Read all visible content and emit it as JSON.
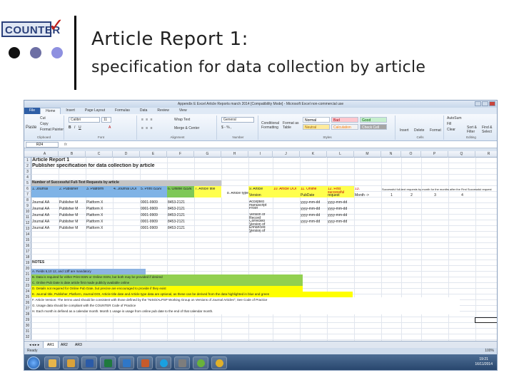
{
  "slide": {
    "logo_text": "COUNTER",
    "title_line1": "Article Report 1:",
    "title_line2": "specification for data collection by article",
    "dot_colors": [
      "#111111",
      "#6d6fa4",
      "#8e90e0"
    ]
  },
  "excel": {
    "window_title": "Appendix E Excel Article Reports march 2014 [Compatibility Mode] - Microsoft Excel non-commercial use",
    "tabs": [
      "File",
      "Home",
      "Insert",
      "Page Layout",
      "Formulas",
      "Data",
      "Review",
      "View"
    ],
    "active_tab": "Home",
    "ribbon": {
      "cut": "Cut",
      "copy": "Copy",
      "format_painter": "Format Painter",
      "paste": "Paste",
      "font_name": "Calibri",
      "font_size": "11",
      "wrap_text": "Wrap Text",
      "merge_center": "Merge & Center",
      "number_format": "General",
      "conditional_formatting": "Conditional Formatting",
      "format_as_table": "Format as Table",
      "style_normal": "Normal",
      "style_bad": "Bad",
      "style_good": "Good",
      "style_neutral": "Neutral",
      "style_calculation": "Calculation",
      "style_check_cell": "Check Cell",
      "insert": "Insert",
      "delete": "Delete",
      "format": "Format",
      "autosum": "AutoSum",
      "fill": "Fill",
      "clear": "Clear",
      "sort_filter": "Sort & Filter",
      "find_select": "Find & Select",
      "group_labels": [
        "Clipboard",
        "Font",
        "Alignment",
        "Number",
        "Styles",
        "Cells",
        "Editing"
      ]
    },
    "name_box": "R24",
    "columns": [
      "A",
      "B",
      "C",
      "D",
      "E",
      "F",
      "G",
      "H",
      "I",
      "J",
      "K",
      "L",
      "M",
      "N",
      "O",
      "P",
      "Q",
      "R"
    ],
    "rows": {
      "r1_title": "Article Report 1",
      "r2_subtitle": "Publisher specification for data collection by article",
      "r5_header": "Number of Successful Full-Text Requests by article",
      "r6": [
        "1. Journal",
        "2. Publisher",
        "3. Platform",
        "4. Journal DOI",
        "5. Print ISSN",
        "6. Online ISSN",
        "7. Article title",
        "9. Article",
        "10. Article DOI",
        "11. Online",
        "12. First successful",
        "13.",
        "Successful full-text requests by month for the months after the First Successful request"
      ],
      "r6_months": [
        "1",
        "2",
        "3",
        "4"
      ],
      "r6_8": "8. Article type",
      "r6_version": "Version",
      "r6_pubdate": "PubDate",
      "r6_request": "request",
      "r6_month": "Month ->",
      "data_rows": [
        [
          "7",
          "Journal AA",
          "Publisher M",
          "Platform X",
          "0001-9909",
          "8453-2121",
          "Accepted manuscript",
          "yyyy-mm-dd",
          "yyyy-mm-dd"
        ],
        [
          "8",
          "Journal AA",
          "Publisher M",
          "Platform X",
          "0001-9909",
          "8453-2121",
          "Proof",
          "yyyy-mm-dd",
          "yyyy-mm-dd"
        ],
        [
          "9",
          "Journal AA",
          "Publisher M",
          "Platform X",
          "0001-9909",
          "8453-2121",
          "Version of Record",
          "yyyy-mm-dd",
          "yyyy-mm-dd"
        ],
        [
          "10",
          "Journal AA",
          "Publisher M",
          "Platform X",
          "0001-9909",
          "8453-2121",
          "Corrected Version of Record",
          "yyyy-mm-dd",
          "yyyy-mm-dd"
        ],
        [
          "11",
          "Journal AA",
          "Publisher M",
          "Platform X",
          "0001-9909",
          "8453-2121",
          "Enhanced Version of Record",
          "",
          ""
        ]
      ],
      "notes_label": "NOTES",
      "notes": [
        "A. Fields 6,10 12, and 13ff are mandatory",
        "B. Data is required for either Print ISSN or Online ISSN, but both may be provided if desired",
        "C. Online Pub Date is date article first made publicly available online",
        "D. Details not required for Online Pub Date, but precise are encouraged to provide if they exist",
        "E. Journal title, Publisher, Platform, Journal DOI, Article title date and Article type data are optional, as these can be derived from the data highlighted in blue and green",
        "F. Article Version: The terms used should be consistent with those defined by the \"NISO/ALPSP Working Group on Versions of Journal Articles\"; See Code of Practice",
        "G. Usage data should be compliant with the COUNTER Code of Practice",
        "H. Each month is defined as a calendar month. Month 1 usage is usage from online pub date to the end of that calendar month."
      ]
    },
    "sheet_tabs": [
      "AR1",
      "AR2",
      "AR3"
    ],
    "active_sheet": "AR1",
    "status": "Ready",
    "zoom": "100%",
    "clock_time": "19:21",
    "clock_date": "16/11/2014",
    "colors": {
      "title_fill": "#c5c5c5",
      "header_blue": "#7fb3e6",
      "header_green": "#7ec857",
      "header_yellow": "#ffff4d",
      "note_green": "#92d050",
      "note_blue": "#8db4e2",
      "note_yellow": "#ffff00"
    }
  }
}
